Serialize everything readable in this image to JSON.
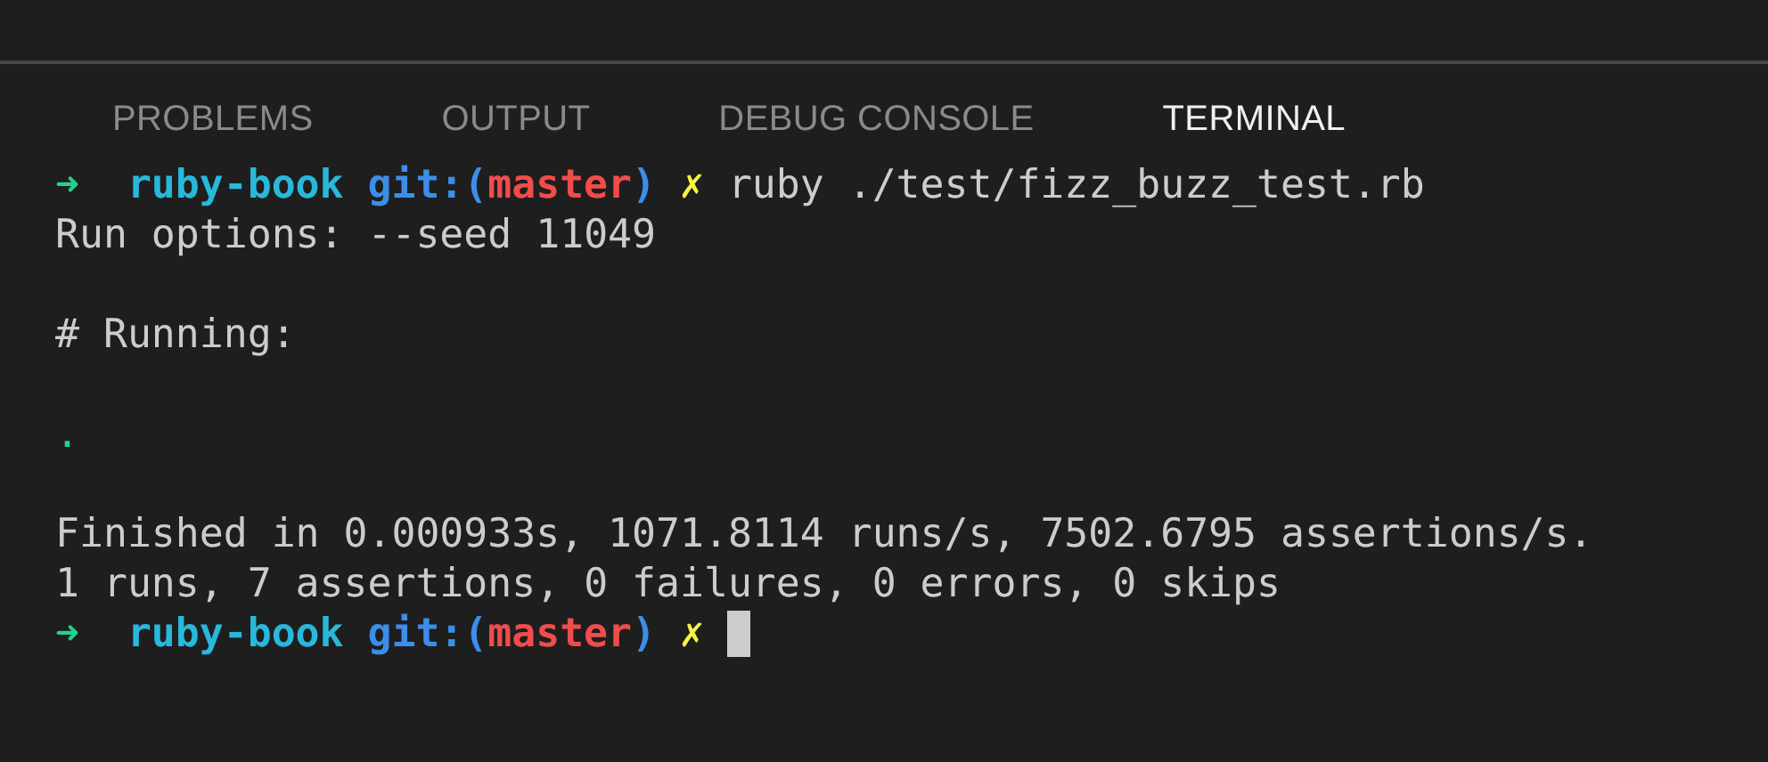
{
  "tabs": [
    {
      "label": "PROBLEMS",
      "selected": false
    },
    {
      "label": "OUTPUT",
      "selected": false
    },
    {
      "label": "DEBUG CONSOLE",
      "selected": false
    },
    {
      "label": "TERMINAL",
      "selected": true
    }
  ],
  "terminal": {
    "lines": [
      {
        "kind": "output",
        "segments": [
          {
            "kind": "arrow",
            "text": "➜"
          },
          {
            "kind": "dir",
            "text": "ruby-book"
          },
          {
            "kind": "git",
            "text": "git:("
          },
          {
            "kind": "branch",
            "text": "master"
          },
          {
            "kind": "gitclose",
            "text": ")"
          },
          {
            "kind": "dirty",
            "text": "✗"
          },
          {
            "kind": "command",
            "text": "ruby ./test/fizz_buzz_test.rb"
          }
        ]
      },
      {
        "kind": "output",
        "segments": [
          {
            "kind": "plain",
            "text": "Run options: --seed 11049"
          }
        ]
      },
      {
        "kind": "blank"
      },
      {
        "kind": "output",
        "segments": [
          {
            "kind": "plain",
            "text": "# Running:"
          }
        ]
      },
      {
        "kind": "blank"
      },
      {
        "kind": "output",
        "segments": [
          {
            "kind": "pass",
            "text": "."
          }
        ]
      },
      {
        "kind": "blank"
      },
      {
        "kind": "output",
        "segments": [
          {
            "kind": "plain",
            "text": "Finished in 0.000933s, 1071.8114 runs/s, 7502.6795 assertions/s."
          }
        ]
      },
      {
        "kind": "output",
        "segments": [
          {
            "kind": "plain",
            "text": "1 runs, 7 assertions, 0 failures, 0 errors, 0 skips"
          }
        ]
      },
      {
        "kind": "output",
        "segments": [
          {
            "kind": "arrow",
            "text": "➜"
          },
          {
            "kind": "dir",
            "text": "ruby-book"
          },
          {
            "kind": "git",
            "text": "git:("
          },
          {
            "kind": "branch",
            "text": "master"
          },
          {
            "kind": "gitclose",
            "text": ")"
          },
          {
            "kind": "dirty",
            "text": "✗"
          },
          {
            "kind": "cursor"
          }
        ]
      }
    ]
  }
}
